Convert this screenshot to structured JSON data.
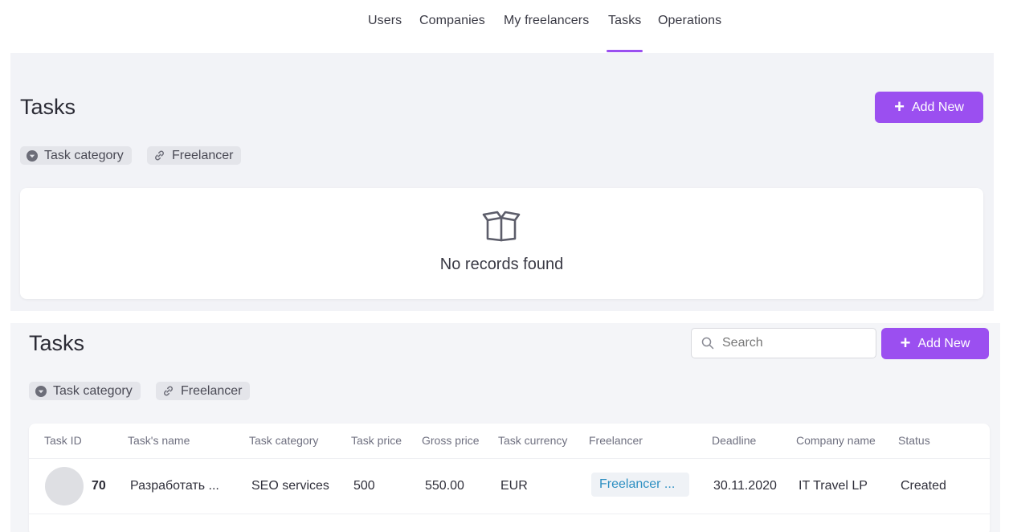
{
  "nav": {
    "items": [
      {
        "label": "Users"
      },
      {
        "label": "Companies"
      },
      {
        "label": "My freelancers"
      },
      {
        "label": "Tasks",
        "active": true
      },
      {
        "label": "Operations"
      }
    ]
  },
  "tasks_empty": {
    "title": "Tasks",
    "add_label": "Add New",
    "chips": [
      "Task category",
      "Freelancer"
    ],
    "empty_text": "No records found"
  },
  "tasks_list": {
    "title": "Tasks",
    "search_placeholder": "Search",
    "add_label": "Add New",
    "chips": [
      "Task category",
      "Freelancer"
    ],
    "columns": [
      "Task ID",
      "Task's name",
      "Task category",
      "Task price",
      "Gross price",
      "Task currency",
      "Freelancer",
      "Deadline",
      "Company name",
      "Status"
    ],
    "rows": [
      {
        "id": "70",
        "name": "Разработать ...",
        "category": "SEO services",
        "price": "500",
        "gross": "550.00",
        "currency": "EUR",
        "freelancer": "Freelancer ...",
        "deadline": "30.11.2020",
        "company": "IT Travel LP",
        "status": "Created"
      }
    ]
  },
  "colors": {
    "accent": "#9b4ff0",
    "link": "#2d8fc2",
    "panel_bg": "#f2f3f7"
  },
  "icons": {
    "chip_category": "caret-down-circle-icon",
    "chip_freelancer": "link-icon",
    "empty": "open-box-icon",
    "search": "search-icon",
    "add": "plus-icon"
  }
}
